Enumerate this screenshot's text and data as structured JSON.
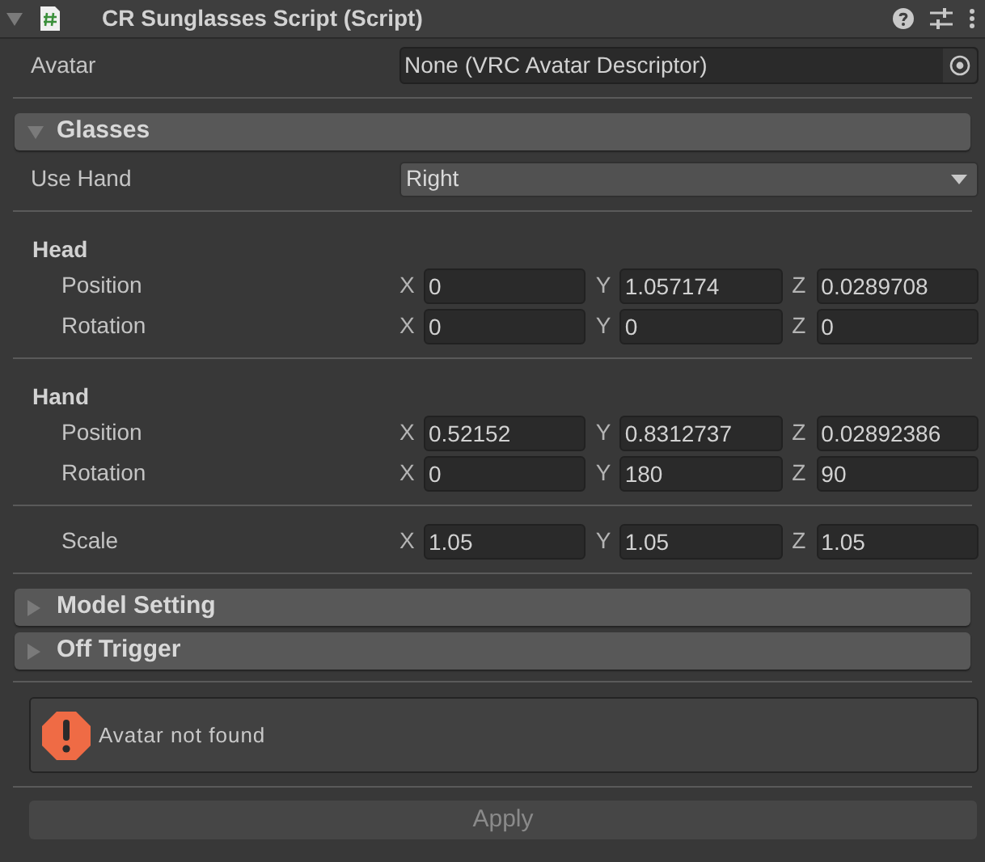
{
  "header": {
    "title": "CR Sunglasses Script (Script)",
    "expanded": true
  },
  "avatar": {
    "label": "Avatar",
    "value": "None (VRC Avatar Descriptor)"
  },
  "sections": [
    {
      "title": "Glasses",
      "expanded": true,
      "items": [
        {
          "kind": "dropdown",
          "label": "Use Hand",
          "value": "Right"
        },
        {
          "kind": "group",
          "title": "Head",
          "rows": [
            {
              "label": "Position",
              "values": [
                {
                  "axis": "X",
                  "value": "0"
                },
                {
                  "axis": "Y",
                  "value": "1.057174"
                },
                {
                  "axis": "Z",
                  "value": "0.0289708"
                }
              ]
            },
            {
              "label": "Rotation",
              "values": [
                {
                  "axis": "X",
                  "value": "0"
                },
                {
                  "axis": "Y",
                  "value": "0"
                },
                {
                  "axis": "Z",
                  "value": "0"
                }
              ]
            }
          ]
        },
        {
          "kind": "group",
          "title": "Hand",
          "rows": [
            {
              "label": "Position",
              "values": [
                {
                  "axis": "X",
                  "value": "0.52152"
                },
                {
                  "axis": "Y",
                  "value": "0.8312737"
                },
                {
                  "axis": "Z",
                  "value": "0.02892386"
                }
              ]
            },
            {
              "label": "Rotation",
              "values": [
                {
                  "axis": "X",
                  "value": "0"
                },
                {
                  "axis": "Y",
                  "value": "180"
                },
                {
                  "axis": "Z",
                  "value": "90"
                }
              ]
            }
          ]
        },
        {
          "kind": "group",
          "rows": [
            {
              "label": "Scale",
              "values": [
                {
                  "axis": "X",
                  "value": "1.05"
                },
                {
                  "axis": "Y",
                  "value": "1.05"
                },
                {
                  "axis": "Z",
                  "value": "1.05"
                }
              ]
            }
          ]
        }
      ]
    },
    {
      "title": "Model Setting",
      "expanded": false
    },
    {
      "title": "Off Trigger",
      "expanded": false
    }
  ],
  "help_box": {
    "kind": "error",
    "message": "Avatar not found"
  },
  "apply_button": {
    "label": "Apply",
    "disabled": true
  }
}
